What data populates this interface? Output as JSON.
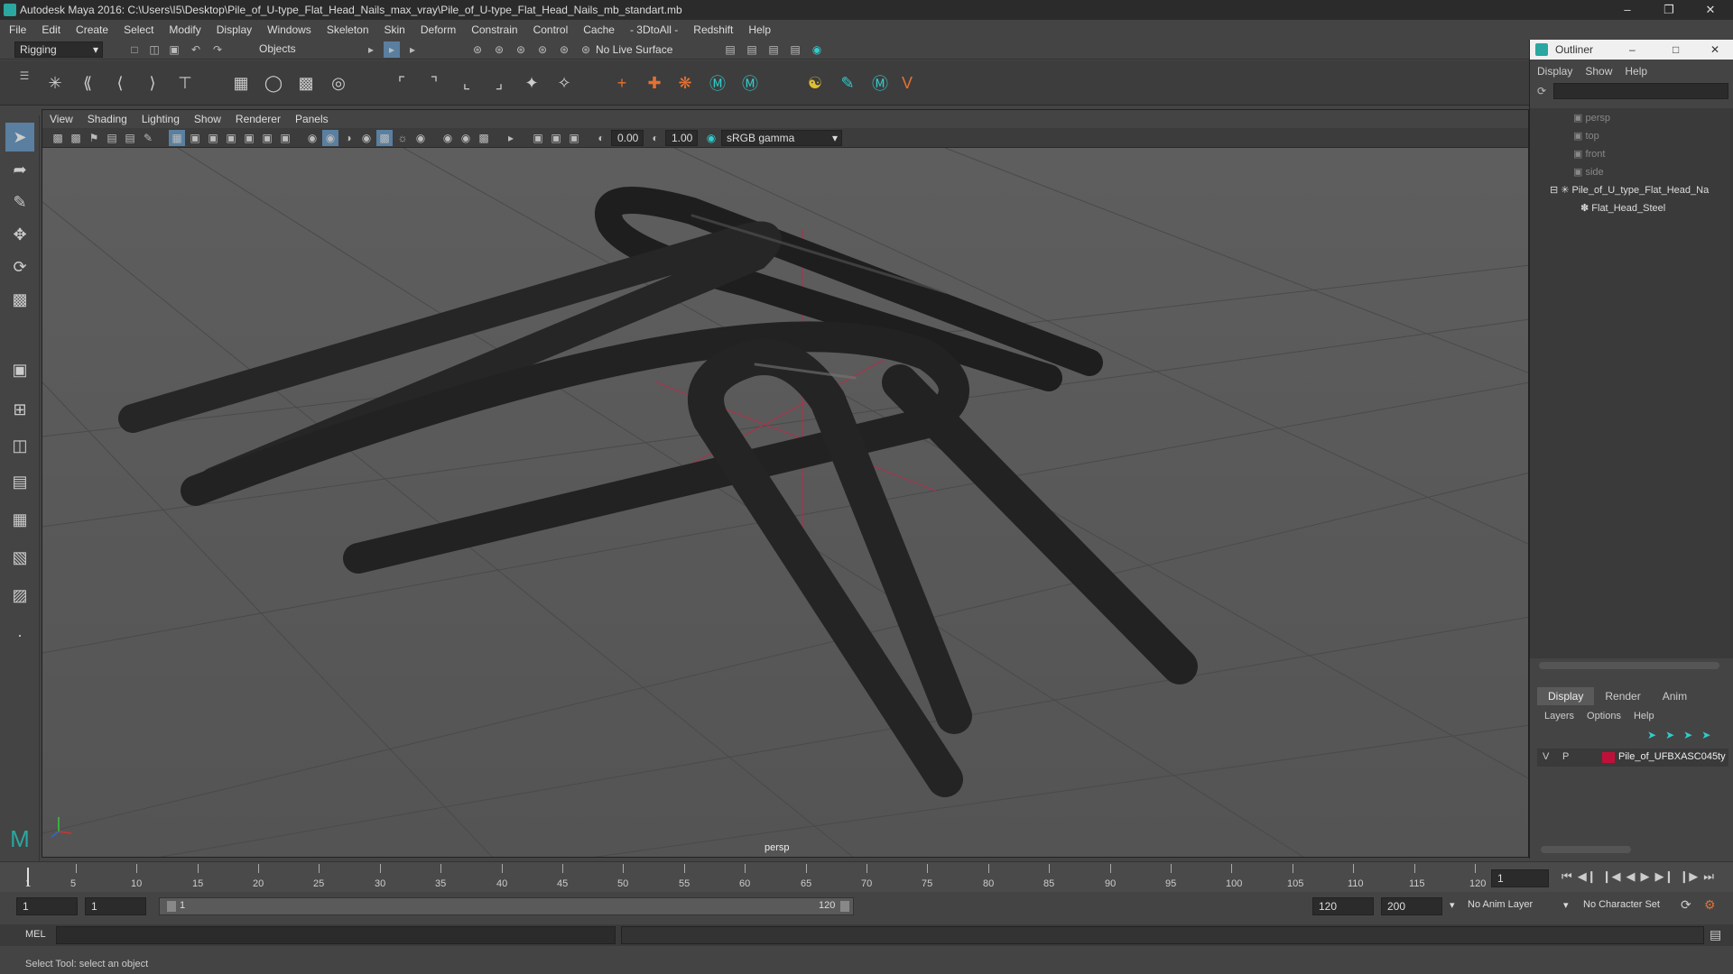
{
  "app": {
    "title": "Autodesk Maya 2016: C:\\Users\\I5\\Desktop\\Pile_of_U-type_Flat_Head_Nails_max_vray\\Pile_of_U-type_Flat_Head_Nails_mb_standart.mb"
  },
  "menu": [
    "File",
    "Edit",
    "Create",
    "Select",
    "Modify",
    "Display",
    "Windows",
    "Skeleton",
    "Skin",
    "Deform",
    "Constrain",
    "Control",
    "Cache",
    "- 3DtoAll -",
    "Redshift",
    "Help"
  ],
  "toolbar": {
    "mode": "Rigging",
    "objects": "Objects",
    "live_surface": "No Live Surface"
  },
  "viewport": {
    "menu": [
      "View",
      "Shading",
      "Lighting",
      "Show",
      "Renderer",
      "Panels"
    ],
    "exposure": "0.00",
    "gamma": "1.00",
    "colorspace": "sRGB gamma",
    "camera_label": "persp"
  },
  "outliner": {
    "title": "Outliner",
    "menu": [
      "Display",
      "Show",
      "Help"
    ],
    "items": [
      "persp",
      "top",
      "front",
      "side",
      "Pile_of_U_type_Flat_Head_Na",
      "Flat_Head_Steel"
    ]
  },
  "layers": {
    "tabs": [
      "Display",
      "Render",
      "Anim"
    ],
    "menu": [
      "Layers",
      "Options",
      "Help"
    ],
    "v": "V",
    "p": "P",
    "layer_name": "Pile_of_UFBXASC045ty",
    "layer_color": "#c0103a"
  },
  "timeline": {
    "ticks": [
      "5",
      "10",
      "15",
      "20",
      "25",
      "30",
      "35",
      "40",
      "45",
      "50",
      "55",
      "60",
      "65",
      "70",
      "75",
      "80",
      "85",
      "90",
      "95",
      "100",
      "105",
      "110",
      "115",
      "120"
    ],
    "start_tick": "1",
    "current_frame": "1"
  },
  "range": {
    "start": "1",
    "playback_start": "1",
    "slider_start": "1",
    "slider_end": "120",
    "playback_end": "120",
    "end": "200",
    "anim_layer": "No Anim Layer",
    "char_set": "No Character Set"
  },
  "cmd": {
    "label": "MEL"
  },
  "help": {
    "text": "Select Tool: select an object"
  }
}
